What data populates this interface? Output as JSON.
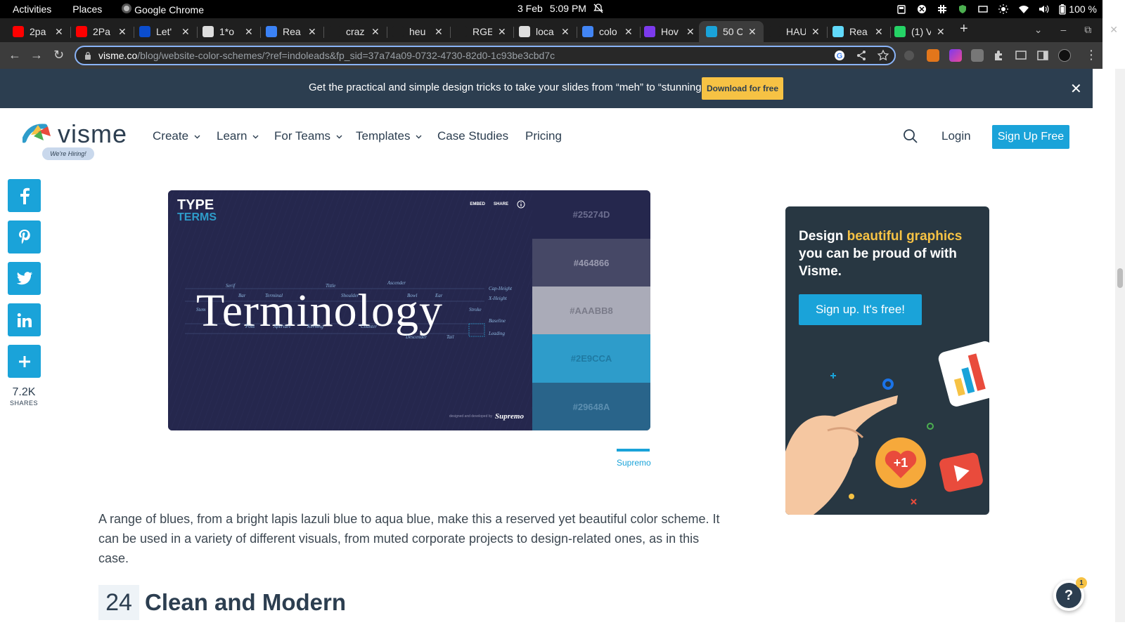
{
  "system": {
    "activities": "Activities",
    "places": "Places",
    "app": "Google Chrome",
    "date": "3 Feb",
    "time": "5:09 PM",
    "battery": "100 %"
  },
  "tabs": [
    {
      "title": "2pa",
      "color": "#ff0000"
    },
    {
      "title": "2Pa",
      "color": "#ff0000"
    },
    {
      "title": "Let'",
      "color": "#0b4dce"
    },
    {
      "title": "1*o",
      "color": "#dddddd"
    },
    {
      "title": "Rea",
      "color": "#3b82f6"
    },
    {
      "title": "craz",
      "color": "#1f1f1f"
    },
    {
      "title": "heu",
      "color": "#1f1f1f"
    },
    {
      "title": "RGE",
      "color": "#1f1f1f"
    },
    {
      "title": "loca",
      "color": "#dddddd"
    },
    {
      "title": "colo",
      "color": "#4285f4"
    },
    {
      "title": "Hov",
      "color": "#7c3aed"
    },
    {
      "title": "50 C",
      "color": "#1aa3d9"
    },
    {
      "title": "HAU",
      "color": "#1f1f1f"
    },
    {
      "title": "Rea",
      "color": "#61dafb"
    },
    {
      "title": "(1) V",
      "color": "#25d366"
    }
  ],
  "browser": {
    "url_host": "visme.co",
    "url_path": "/blog/website-color-schemes/?ref=indoleads&fp_sid=37a74a09-0732-4730-82d0-1c93be3cbd7c"
  },
  "promo": {
    "text": "Get the practical and simple design tricks to take your slides from “meh” to “stunning”!",
    "button": "Download for free",
    "close": "✕"
  },
  "nav": {
    "logo": "visme",
    "hiring": "We're Hiring!",
    "items": [
      "Create",
      "Learn",
      "For Teams",
      "Templates",
      "Case Studies",
      "Pricing"
    ],
    "login": "Login",
    "signup": "Sign Up Free"
  },
  "share": {
    "count": "7.2K",
    "label": "SHARES"
  },
  "palette": {
    "logo_line1": "TYPE",
    "logo_line2": "TERMS",
    "embed": "EMBED",
    "share": "SHARE",
    "word": "Terminology",
    "annotations": [
      "Serif",
      "Bar",
      "Terminal",
      "Stem",
      "Tittle",
      "Shoulder",
      "Ascender",
      "Bowl",
      "Ear",
      "Cap-Height",
      "X-Height",
      "Stroke",
      "Foot",
      "Aperture",
      "Kerning",
      "Counter",
      "Descender",
      "Tail",
      "Baseline",
      "Leading"
    ],
    "credit_small": "designed and developed by",
    "credit_brand": "Supremo",
    "swatches": [
      {
        "hex": "#25274D",
        "text_color": "#6b6d8f"
      },
      {
        "hex": "#464866",
        "text_color": "#9a9bb0"
      },
      {
        "hex": "#AAABB8",
        "text_color": "#7a7b89"
      },
      {
        "hex": "#2E9CCA",
        "text_color": "#1f7aa3"
      },
      {
        "hex": "#29648A",
        "text_color": "#5d8fb0"
      }
    ],
    "caption": "Supremo"
  },
  "article": {
    "paragraph": "A range of blues, from a bright lapis lazuli blue to aqua blue, make this a reserved yet beautiful color scheme. It can be used in a variety of different visuals, from muted corporate projects to design-related ones, as in this case.",
    "section_num": "24",
    "section_title": "Clean and Modern"
  },
  "ad": {
    "head_1": "Design ",
    "head_hl": "beautiful graphics",
    "head_2": " you can be proud of with Visme.",
    "cta": "Sign up. It's free!",
    "badge": "+1"
  },
  "help": {
    "icon": "?",
    "badge": "1"
  }
}
